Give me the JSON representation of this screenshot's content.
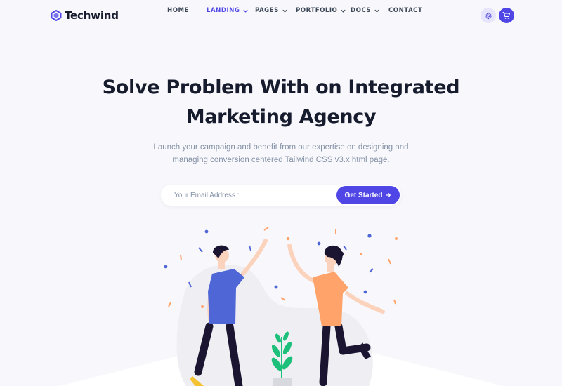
{
  "brand": {
    "name": "Techwind",
    "accent": "#4f46e5"
  },
  "nav": {
    "items": [
      {
        "label": "HOME",
        "dropdown": false,
        "active": false
      },
      {
        "label": "LANDING",
        "dropdown": true,
        "active": true
      },
      {
        "label": "PAGES",
        "dropdown": true,
        "active": false
      },
      {
        "label": "PORTFOLIO",
        "dropdown": true,
        "active": false
      },
      {
        "label": "DOCS",
        "dropdown": true,
        "active": false
      },
      {
        "label": "CONTACT",
        "dropdown": false,
        "active": false
      }
    ],
    "icons": [
      "gear-icon",
      "cart-icon"
    ]
  },
  "hero": {
    "title_line1": "Solve Problem With on Integrated",
    "title_line2": "Marketing Agency",
    "subtitle_line1": "Launch your campaign and benefit from our expertise on designing and",
    "subtitle_line2": "managing conversion centered Tailwind CSS v3.x html page.",
    "email_placeholder": "Your Email Address :",
    "cta_label": "Get Started",
    "cta_icon": "arrow-right-icon"
  },
  "colors": {
    "background": "#f8f8fc",
    "heading": "#161c2d",
    "muted": "#8492a6",
    "person_left_shirt": "#4f67d6",
    "person_right_shirt": "#ffa36b",
    "plant": "#1dc07a"
  }
}
